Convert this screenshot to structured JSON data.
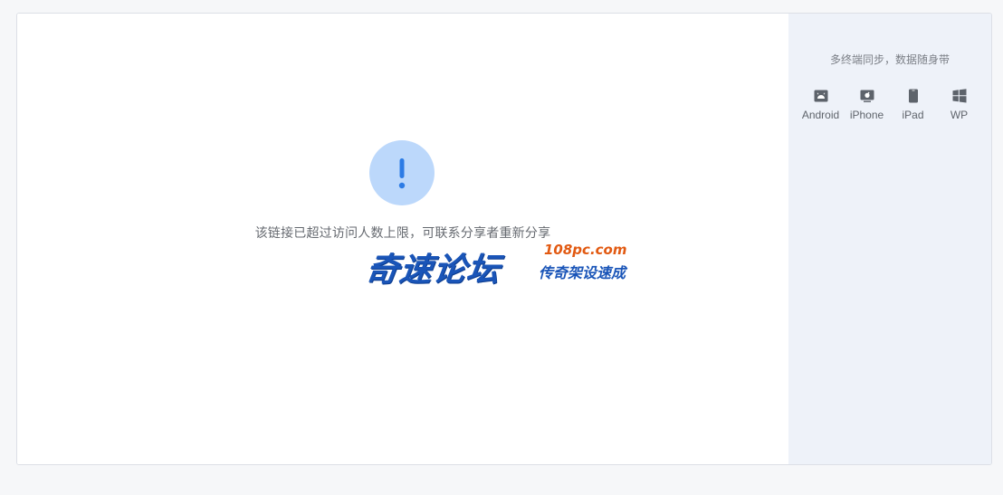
{
  "main": {
    "message": "该链接已超过访问人数上限，可联系分享者重新分享",
    "alert_color": "#bcd8fb",
    "alert_mark_color": "#2c7be5"
  },
  "watermark": {
    "name": "奇速论坛",
    "domain": "108pc.com",
    "tagline": "传奇架设速成"
  },
  "sidebar": {
    "title": "多终端同步，数据随身带",
    "platforms": [
      {
        "label": "Android",
        "icon": "android-icon"
      },
      {
        "label": "iPhone",
        "icon": "apple-icon"
      },
      {
        "label": "iPad",
        "icon": "tablet-icon"
      },
      {
        "label": "WP",
        "icon": "windows-icon"
      }
    ]
  }
}
